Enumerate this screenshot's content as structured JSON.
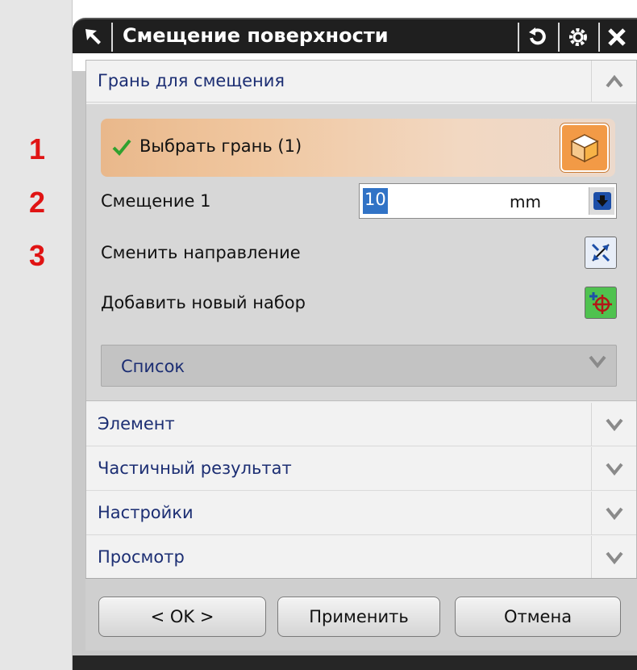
{
  "annotations": [
    "1",
    "2",
    "3"
  ],
  "dialog": {
    "title": "Смещение поверхности",
    "icons": {
      "arrow": "select-arrow-icon",
      "reset": "reset-icon",
      "settings": "gear-icon",
      "close": "close-icon"
    }
  },
  "group_face": {
    "header": "Грань для смещения",
    "expanded": true,
    "select_face_label": "Выбрать грань (1)",
    "offset": {
      "label": "Смещение 1",
      "value": "10",
      "unit": "mm"
    },
    "reverse_direction_label": "Сменить направление",
    "add_new_set_label": "Добавить новый набор",
    "list_label": "Список"
  },
  "sections": [
    {
      "label": "Элемент",
      "expanded": false
    },
    {
      "label": "Частичный результат",
      "expanded": false
    },
    {
      "label": "Настройки",
      "expanded": false
    },
    {
      "label": "Просмотр",
      "expanded": false
    }
  ],
  "buttons": {
    "ok": "< OK >",
    "apply": "Применить",
    "cancel": "Отмена"
  },
  "colors": {
    "title_bar": "#1f1f1f",
    "section_text": "#1c2e73",
    "annotation": "#e01414",
    "selection_highlight": "#3173c6",
    "face_button": "#f29a46"
  }
}
